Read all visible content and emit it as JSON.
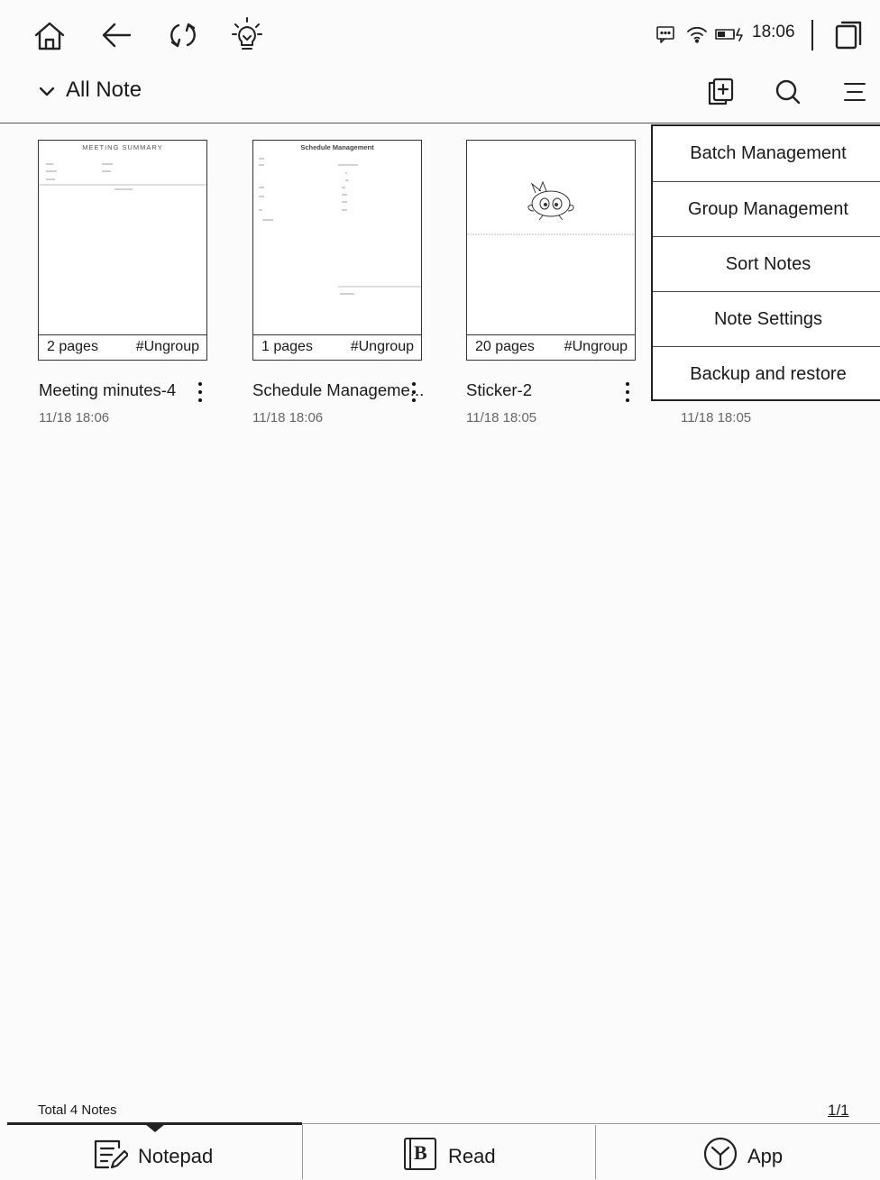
{
  "status_bar": {
    "time": "18:06"
  },
  "header": {
    "title": "All Note"
  },
  "notes": [
    {
      "title": "Meeting minutes-4",
      "date": "11/18 18:06",
      "pages": "2 pages",
      "group": "#Ungroup",
      "thumb_heading": "MEETING SUMMARY"
    },
    {
      "title": "Schedule Manageme...",
      "date": "11/18 18:06",
      "pages": "1 pages",
      "group": "#Ungroup",
      "thumb_heading": "Schedule Management"
    },
    {
      "title": "Sticker-2",
      "date": "11/18 18:05",
      "pages": "20 pages",
      "group": "#Ungroup"
    },
    {
      "date": "11/18 18:05"
    }
  ],
  "menu": {
    "items": [
      {
        "label": "Batch Management"
      },
      {
        "label": "Group Management"
      },
      {
        "label": "Sort Notes"
      },
      {
        "label": "Note Settings"
      },
      {
        "label": "Backup and restore"
      }
    ]
  },
  "footer": {
    "total": "Total 4 Notes",
    "pager": "1/1"
  },
  "tabs": [
    {
      "label": "Notepad",
      "icon": "notepad-icon",
      "active": true
    },
    {
      "label": "Read",
      "icon": "book-icon"
    },
    {
      "label": "App",
      "icon": "app-cube-icon"
    }
  ],
  "icons": [
    "home-icon",
    "back-arrow-icon",
    "refresh-icon",
    "lightbulb-icon",
    "message-icon",
    "wifi-icon",
    "battery-icon",
    "window-icon",
    "new-note-icon",
    "search-icon",
    "menu-icon",
    "chevron-down-icon"
  ]
}
